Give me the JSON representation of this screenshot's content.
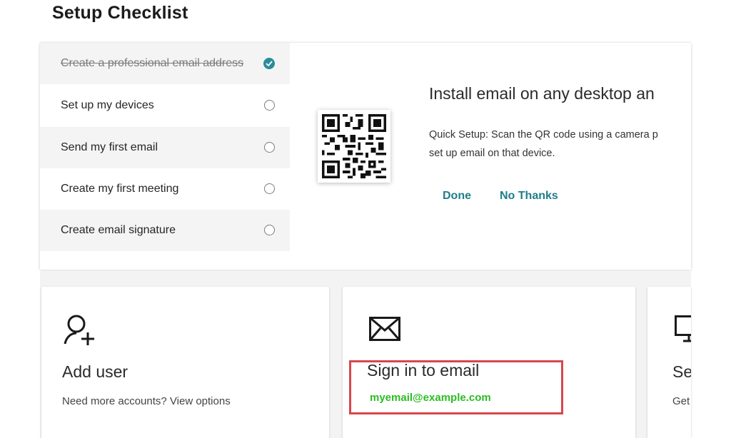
{
  "page": {
    "title": "Setup Checklist"
  },
  "checklist": {
    "items": [
      {
        "label": "Create a professional email address",
        "completed": true
      },
      {
        "label": "Set up my devices",
        "completed": false
      },
      {
        "label": "Send my first email",
        "completed": false
      },
      {
        "label": "Create my first meeting",
        "completed": false
      },
      {
        "label": "Create email signature",
        "completed": false
      }
    ]
  },
  "detail": {
    "heading": "Install email on any desktop an",
    "description": "Quick Setup: Scan the QR code using a camera p",
    "description_line2": "set up email on that device.",
    "done_label": "Done",
    "no_thanks_label": "No Thanks"
  },
  "cards": [
    {
      "title": "Add user",
      "text": "Need more accounts?",
      "link": "View options",
      "icon": "add-user-icon"
    },
    {
      "title": "Sign in to email",
      "icon": "envelope-icon"
    },
    {
      "title": "Se",
      "text": "Get",
      "icon": "monitor-icon"
    }
  ],
  "annotation": {
    "email": "myemail@example.com",
    "box_color": "#d9464a",
    "email_color": "#2bbd24"
  },
  "colors": {
    "accent": "#207e8a",
    "check": "#2a8c9b"
  }
}
